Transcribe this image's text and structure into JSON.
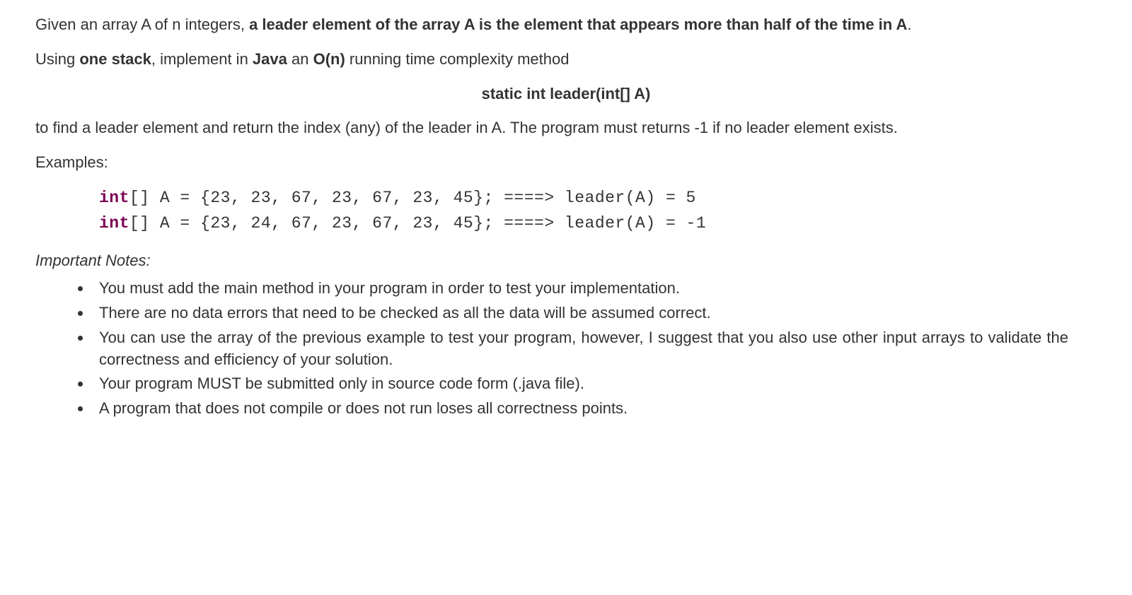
{
  "p1": {
    "t1": "Given  an  array A of n integers,  ",
    "b1": "a leader element of the array A is the element that appears more than half of the time in A",
    "t2": "."
  },
  "p2": {
    "t1": "Using ",
    "b1": "one stack",
    "t2": ", implement in ",
    "b2": "Java",
    "t3": " an ",
    "b3": "O(n)",
    "t4": " running time complexity method"
  },
  "sig": "static int leader(int[] A)",
  "p3": "to find a leader element and return the index (any) of the leader in A. The program must returns -1 if no leader element exists.",
  "examples_label": "Examples:",
  "ex1": {
    "kw": "int",
    "rest": "[] A = {23, 23, 67, 23, 67, 23, 45}; ====> leader(A) = 5"
  },
  "ex2": {
    "kw": "int",
    "rest": "[] A = {23, 24, 67, 23, 67, 23, 45}; ====> leader(A) = -1"
  },
  "notes_header": "Important Notes:",
  "notes": [
    "You must add the main method in your program in order to test your implementation.",
    "There are no data errors that need to be checked as all the data will be assumed correct.",
    "You can use the array of the previous example to test your program, however, I suggest that you also use other input arrays to validate the correctness and efficiency of your solution.",
    "Your program MUST be submitted only in source code form (.java file).",
    "A program that does not compile or does not run loses all correctness points."
  ]
}
